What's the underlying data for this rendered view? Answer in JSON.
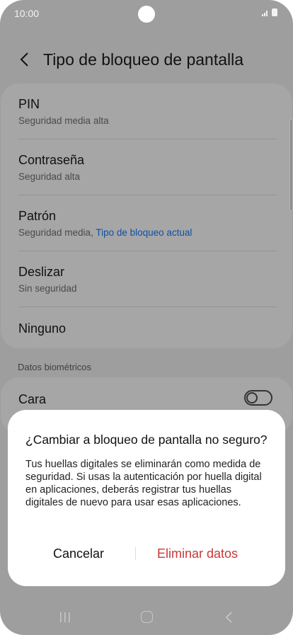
{
  "status_bar": {
    "time": "10:00"
  },
  "header": {
    "title": "Tipo de bloqueo de pantalla"
  },
  "options": [
    {
      "title": "PIN",
      "subtitle": "Seguridad media alta"
    },
    {
      "title": "Contraseña",
      "subtitle": "Seguridad alta"
    },
    {
      "title": "Patrón",
      "subtitle": "Seguridad media, ",
      "subtitle_accent": "Tipo de bloqueo actual"
    },
    {
      "title": "Deslizar",
      "subtitle": "Sin seguridad"
    },
    {
      "title": "Ninguno"
    }
  ],
  "biometrics": {
    "section_label": "Datos biométricos",
    "face_label": "Cara",
    "face_enabled": false
  },
  "dialog": {
    "title": "¿Cambiar a bloqueo de pantalla no seguro?",
    "message": "Tus huellas digitales se eliminarán como medida de seguridad. Si usas la autenticación por huella digital en aplicaciones, deberás registrar tus huellas digitales de nuevo para usar esas aplicaciones.",
    "cancel_label": "Cancelar",
    "confirm_label": "Eliminar datos"
  },
  "colors": {
    "accent_link": "#0f4fa8",
    "destructive": "#c83737",
    "dimmed_background": "#9e9e9e"
  },
  "icons": [
    "back-arrow-icon",
    "recents-icon",
    "home-icon",
    "nav-back-icon",
    "signal-icon",
    "battery-icon"
  ]
}
